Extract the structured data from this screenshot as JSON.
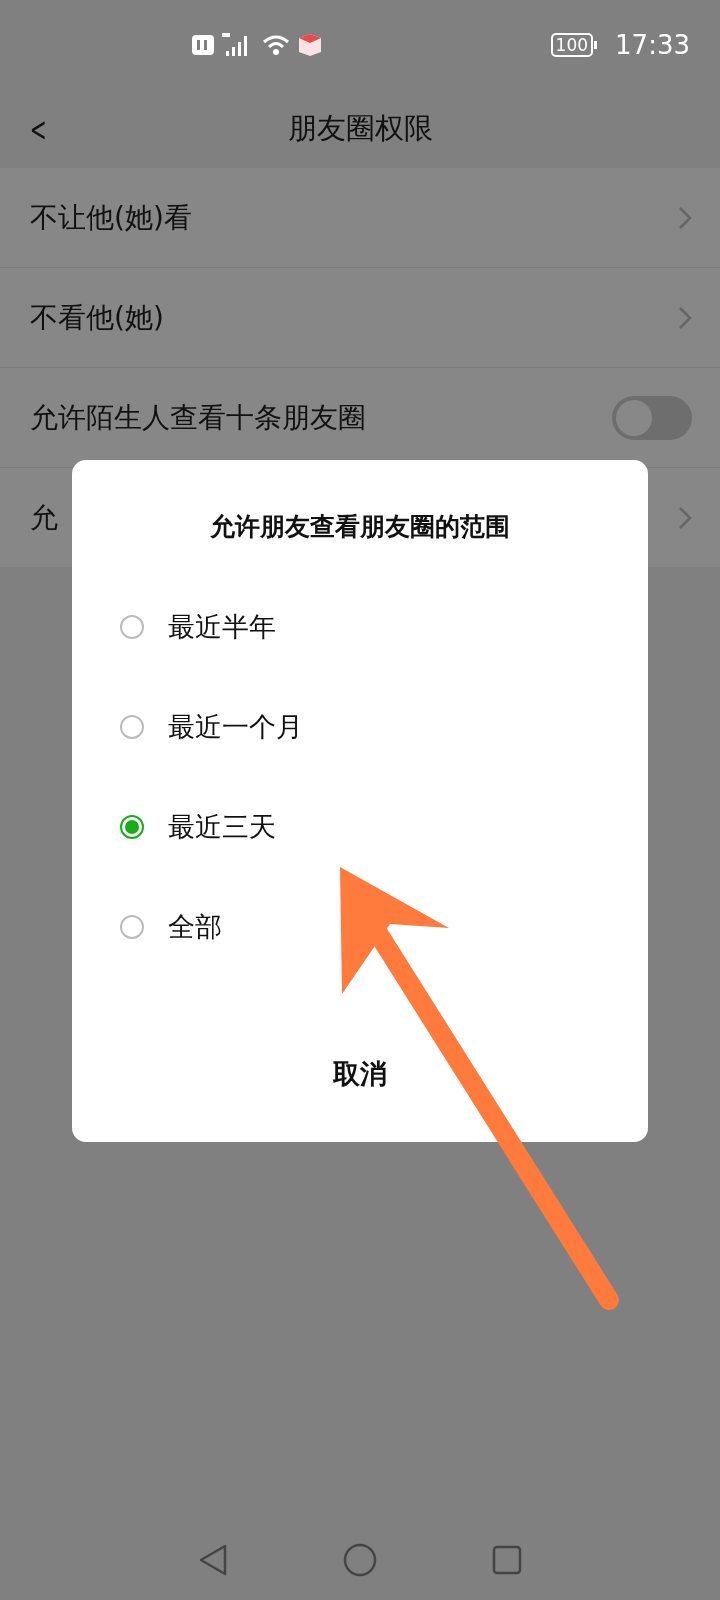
{
  "status_bar": {
    "battery": "100",
    "time": "17:33"
  },
  "header": {
    "back": "<",
    "title": "朋友圈权限"
  },
  "settings": [
    {
      "kind": "link",
      "label": "不让他(她)看"
    },
    {
      "kind": "link",
      "label": "不看他(她)"
    },
    {
      "kind": "toggle",
      "label": "允许陌生人查看十条朋友圈",
      "on": false
    },
    {
      "kind": "link",
      "label": "允"
    }
  ],
  "dialog": {
    "title": "允许朋友查看朋友圈的范围",
    "options": [
      {
        "label": "最近半年",
        "selected": false
      },
      {
        "label": "最近一个月",
        "selected": false
      },
      {
        "label": "最近三天",
        "selected": true
      },
      {
        "label": "全部",
        "selected": false
      }
    ],
    "cancel": "取消"
  }
}
